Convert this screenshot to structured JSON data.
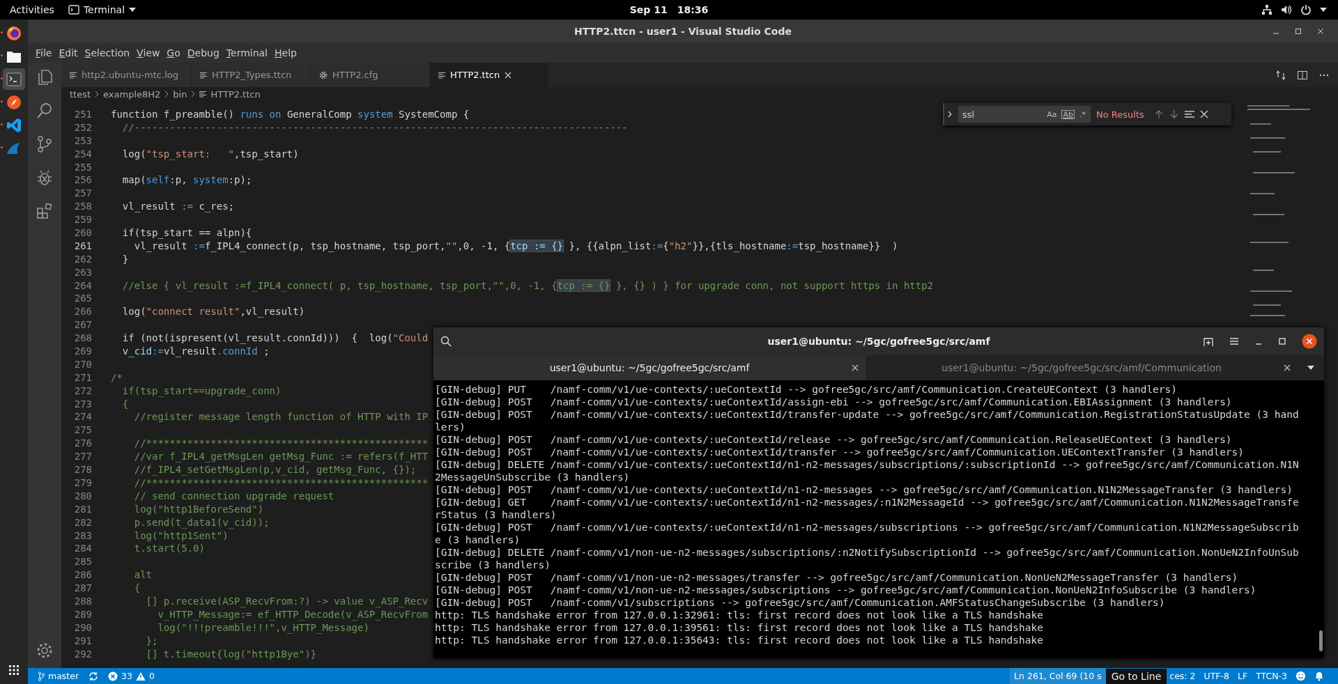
{
  "top_bar": {
    "activities": "Activities",
    "app": "Terminal",
    "date": "Sep 11",
    "time": "18:36"
  },
  "dock": [
    {
      "kind": "browser",
      "running": true,
      "selected": false
    },
    {
      "kind": "files",
      "running": true,
      "selected": false
    },
    {
      "kind": "terminal",
      "running": true,
      "selected": true
    },
    {
      "kind": "compass",
      "running": true,
      "selected": false
    },
    {
      "kind": "editor",
      "running": true,
      "selected": false
    },
    {
      "kind": "fin",
      "running": true,
      "selected": false
    }
  ],
  "window": {
    "title": "HTTP2.ttcn - user1 - Visual Studio Code"
  },
  "menu": [
    "File",
    "Edit",
    "Selection",
    "View",
    "Go",
    "Debug",
    "Terminal",
    "Help"
  ],
  "editor": {
    "tabs": [
      {
        "label": "http2.ubuntu-mtc.log",
        "kind": "file",
        "selected": false
      },
      {
        "label": "HTTP2_Types.ttcn",
        "kind": "file",
        "selected": false
      },
      {
        "label": "HTTP2.cfg",
        "kind": "settings",
        "selected": false
      },
      {
        "label": "HTTP2.ttcn",
        "kind": "file",
        "selected": true
      }
    ],
    "breadcrumb": [
      "ttest",
      "example8H2",
      "bin",
      "HTTP2.ttcn"
    ],
    "find": {
      "value": "ssl",
      "options": [
        {
          "label": "Aa",
          "selected": false
        },
        {
          "label": "Ab",
          "selected": false
        },
        {
          "label": ".*",
          "selected": false
        }
      ],
      "result": "No Results"
    },
    "lines": [
      {
        "number": "251",
        "current": false,
        "segs": [
          {
            "kind": "plain",
            "text": "function f_preamble() "
          },
          {
            "kind": "keyword",
            "text": "runs on"
          },
          {
            "kind": "plain",
            "text": " GeneralComp "
          },
          {
            "kind": "keyword",
            "text": "system"
          },
          {
            "kind": "plain",
            "text": " SystemComp {"
          }
        ]
      },
      {
        "number": "252",
        "current": false,
        "segs": [
          {
            "kind": "comment",
            "text": "  //------------------------------------------------------------------------------------"
          }
        ]
      },
      {
        "number": "253",
        "current": false
      },
      {
        "number": "254",
        "current": false,
        "segs": [
          {
            "kind": "plain",
            "text": "  log("
          },
          {
            "kind": "string",
            "text": "\"tsp_start:   \""
          },
          {
            "kind": "plain",
            "text": ",tsp_start)"
          }
        ]
      },
      {
        "number": "255",
        "current": false
      },
      {
        "number": "256",
        "current": false,
        "segs": [
          {
            "kind": "plain",
            "text": "  map("
          },
          {
            "kind": "keyword",
            "text": "self"
          },
          {
            "kind": "plain",
            "text": ":p, "
          },
          {
            "kind": "keyword",
            "text": "system"
          },
          {
            "kind": "plain",
            "text": ":p);"
          }
        ]
      },
      {
        "number": "257",
        "current": false
      },
      {
        "number": "258",
        "current": false,
        "segs": [
          {
            "kind": "plain",
            "text": "  vl_result "
          },
          {
            "kind": "keyword",
            "text": ":="
          },
          {
            "kind": "plain",
            "text": " c_res;"
          }
        ]
      },
      {
        "number": "259",
        "current": false
      },
      {
        "number": "260",
        "current": false,
        "segs": [
          {
            "kind": "plain",
            "text": "  if(tsp_start == alpn){"
          }
        ]
      },
      {
        "number": "261",
        "current": true,
        "segs": [
          {
            "kind": "plain",
            "text": "    vl_result "
          },
          {
            "kind": "keyword",
            "text": ":="
          },
          {
            "kind": "plain",
            "text": "f_IPL4_connect(p, tsp_hostname, tsp_port,"
          },
          {
            "kind": "string",
            "text": "\"\""
          },
          {
            "kind": "plain",
            "text": ",0, -1, {"
          },
          {
            "kind": "match",
            "text": "tcp := {}"
          },
          {
            "kind": "plain",
            "text": " }, {{alpn_list"
          },
          {
            "kind": "keyword",
            "text": ":="
          },
          {
            "kind": "plain",
            "text": "{"
          },
          {
            "kind": "string",
            "text": "\"h2\""
          },
          {
            "kind": "plain",
            "text": "}},{tls_hostname"
          },
          {
            "kind": "keyword",
            "text": ":="
          },
          {
            "kind": "plain",
            "text": "tsp_hostname}}  )"
          }
        ]
      },
      {
        "number": "262",
        "current": false,
        "segs": [
          {
            "kind": "plain",
            "text": "  }"
          }
        ]
      },
      {
        "number": "263",
        "current": false
      },
      {
        "number": "264",
        "current": false,
        "segs": [
          {
            "kind": "comment",
            "text": "  //else { vl_result :=f_IPL4_connect( p, tsp_hostname, tsp_port,\"\",0, -1, {"
          },
          {
            "kind": "comment-match",
            "text": "tcp := {}"
          },
          {
            "kind": "comment",
            "text": " }, {} ) } for upgrade conn, not support https in http2"
          }
        ]
      },
      {
        "number": "265",
        "current": false
      },
      {
        "number": "266",
        "current": false,
        "segs": [
          {
            "kind": "plain",
            "text": "  log("
          },
          {
            "kind": "string",
            "text": "\"connect result\""
          },
          {
            "kind": "plain",
            "text": ",vl_result)"
          }
        ]
      },
      {
        "number": "267",
        "current": false
      },
      {
        "number": "268",
        "current": false,
        "segs": [
          {
            "kind": "plain",
            "text": "  if (not(ispresent(vl_result.connId)))  {  log("
          },
          {
            "kind": "string",
            "text": "\"Could"
          }
        ]
      },
      {
        "number": "269",
        "current": false,
        "segs": [
          {
            "kind": "field",
            "text": "  v_cid"
          },
          {
            "kind": "keyword",
            "text": ":="
          },
          {
            "kind": "plain",
            "text": "vl_result"
          },
          {
            "kind": "keyword",
            "text": ".connId"
          },
          {
            "kind": "plain",
            "text": " ;"
          }
        ]
      },
      {
        "number": "270",
        "current": false
      },
      {
        "number": "271",
        "current": false,
        "segs": [
          {
            "kind": "comment",
            "text": "/*"
          }
        ]
      },
      {
        "number": "272",
        "current": false,
        "segs": [
          {
            "kind": "comment",
            "text": "  if(tsp_start==upgrade_conn)"
          }
        ]
      },
      {
        "number": "273",
        "current": false,
        "segs": [
          {
            "kind": "comment",
            "text": "  {"
          }
        ]
      },
      {
        "number": "274",
        "current": false,
        "segs": [
          {
            "kind": "comment",
            "text": "    //register message length function of HTTP with IP"
          }
        ]
      },
      {
        "number": "275",
        "current": false
      },
      {
        "number": "276",
        "current": false,
        "segs": [
          {
            "kind": "comment",
            "text": "    //************************************************"
          }
        ]
      },
      {
        "number": "277",
        "current": false,
        "segs": [
          {
            "kind": "comment",
            "text": "    //var f_IPL4_getMsgLen getMsg_Func := refers(f_HTT"
          }
        ]
      },
      {
        "number": "278",
        "current": false,
        "segs": [
          {
            "kind": "comment",
            "text": "    //f_IPL4_setGetMsgLen(p,v_cid, getMsg_Func, {});"
          }
        ]
      },
      {
        "number": "279",
        "current": false,
        "segs": [
          {
            "kind": "comment",
            "text": "    //************************************************"
          }
        ]
      },
      {
        "number": "280",
        "current": false,
        "segs": [
          {
            "kind": "comment",
            "text": "    // send connection upgrade request"
          }
        ]
      },
      {
        "number": "281",
        "current": false,
        "segs": [
          {
            "kind": "comment",
            "text": "    log(\"http1BeforeSend\")"
          }
        ]
      },
      {
        "number": "282",
        "current": false,
        "segs": [
          {
            "kind": "comment",
            "text": "    p.send(t_data1(v_cid));"
          }
        ]
      },
      {
        "number": "283",
        "current": false,
        "segs": [
          {
            "kind": "comment",
            "text": "    log(\"http1Sent\")"
          }
        ]
      },
      {
        "number": "284",
        "current": false,
        "segs": [
          {
            "kind": "comment",
            "text": "    t.start(5.0)"
          }
        ]
      },
      {
        "number": "285",
        "current": false
      },
      {
        "number": "286",
        "current": false,
        "segs": [
          {
            "kind": "comment",
            "text": "    alt"
          }
        ]
      },
      {
        "number": "287",
        "current": false,
        "segs": [
          {
            "kind": "comment",
            "text": "    {"
          }
        ]
      },
      {
        "number": "288",
        "current": false,
        "segs": [
          {
            "kind": "comment",
            "text": "      [] p.receive(ASP_RecvFrom:?) -> value v_ASP_Recv"
          }
        ]
      },
      {
        "number": "289",
        "current": false,
        "segs": [
          {
            "kind": "comment",
            "text": "        v_HTTP_Message:= ef_HTTP_Decode(v_ASP_RecvFrom"
          }
        ]
      },
      {
        "number": "290",
        "current": false,
        "segs": [
          {
            "kind": "comment",
            "text": "        log(\"!!!preamble!!!\",v_HTTP_Message)"
          }
        ]
      },
      {
        "number": "291",
        "current": false,
        "segs": [
          {
            "kind": "comment",
            "text": "      };"
          }
        ]
      },
      {
        "number": "292",
        "current": false,
        "segs": [
          {
            "kind": "comment",
            "text": "      [] t.timeout{log(\"http1Bye\")}"
          }
        ]
      }
    ]
  },
  "terminal": {
    "title": "user1@ubuntu: ~/5gc/gofree5gc/src/amf",
    "tabs": [
      {
        "label": "user1@ubuntu: ~/5gc/gofree5gc/src/amf",
        "selected": true
      },
      {
        "label": "user1@ubuntu: ~/5gc/gofree5gc/src/amf/Communication",
        "selected": false
      }
    ],
    "lines": [
      "[GIN-debug] PUT    /namf-comm/v1/ue-contexts/:ueContextId --> gofree5gc/src/amf/Communication.CreateUEContext (3 handlers)",
      "[GIN-debug] POST   /namf-comm/v1/ue-contexts/:ueContextId/assign-ebi --> gofree5gc/src/amf/Communication.EBIAssignment (3 handlers)",
      "[GIN-debug] POST   /namf-comm/v1/ue-contexts/:ueContextId/transfer-update --> gofree5gc/src/amf/Communication.RegistrationStatusUpdate (3 hand",
      "lers)",
      "[GIN-debug] POST   /namf-comm/v1/ue-contexts/:ueContextId/release --> gofree5gc/src/amf/Communication.ReleaseUEContext (3 handlers)",
      "[GIN-debug] POST   /namf-comm/v1/ue-contexts/:ueContextId/transfer --> gofree5gc/src/amf/Communication.UEContextTransfer (3 handlers)",
      "[GIN-debug] DELETE /namf-comm/v1/ue-contexts/:ueContextId/n1-n2-messages/subscriptions/:subscriptionId --> gofree5gc/src/amf/Communication.N1N",
      "2MessageUnSubscribe (3 handlers)",
      "[GIN-debug] POST   /namf-comm/v1/ue-contexts/:ueContextId/n1-n2-messages --> gofree5gc/src/amf/Communication.N1N2MessageTransfer (3 handlers)",
      "[GIN-debug] GET    /namf-comm/v1/ue-contexts/:ueContextId/n1-n2-messages/:n1N2MessageId --> gofree5gc/src/amf/Communication.N1N2MessageTransfe",
      "rStatus (3 handlers)",
      "[GIN-debug] POST   /namf-comm/v1/ue-contexts/:ueContextId/n1-n2-messages/subscriptions --> gofree5gc/src/amf/Communication.N1N2MessageSubscrib",
      "e (3 handlers)",
      "[GIN-debug] DELETE /namf-comm/v1/non-ue-n2-messages/subscriptions/:n2NotifySubscriptionId --> gofree5gc/src/amf/Communication.NonUeN2InfoUnSub",
      "scribe (3 handlers)",
      "[GIN-debug] POST   /namf-comm/v1/non-ue-n2-messages/transfer --> gofree5gc/src/amf/Communication.NonUeN2MessageTransfer (3 handlers)",
      "[GIN-debug] POST   /namf-comm/v1/non-ue-n2-messages/subscriptions --> gofree5gc/src/amf/Communication.NonUeN2InfoSubscribe (3 handlers)",
      "[GIN-debug] POST   /namf-comm/v1/subscriptions --> gofree5gc/src/amf/Communication.AMFStatusChangeSubscribe (3 handlers)",
      "http: TLS handshake error from 127.0.0.1:32961: tls: first record does not look like a TLS handshake",
      "http: TLS handshake error from 127.0.0.1:39561: tls: first record does not look like a TLS handshake",
      "http: TLS handshake error from 127.0.0.1:35643: tls: first record does not look like a TLS handshake"
    ]
  },
  "status_bar": {
    "branch": "master",
    "errors": "33",
    "warnings": "0",
    "cursor": "Ln 261, Col 69 (10 s",
    "tooltip": "Go to Line",
    "indent": "ces: 2",
    "encoding": "UTF-8",
    "eol": "LF",
    "language": "TTCN-3"
  }
}
